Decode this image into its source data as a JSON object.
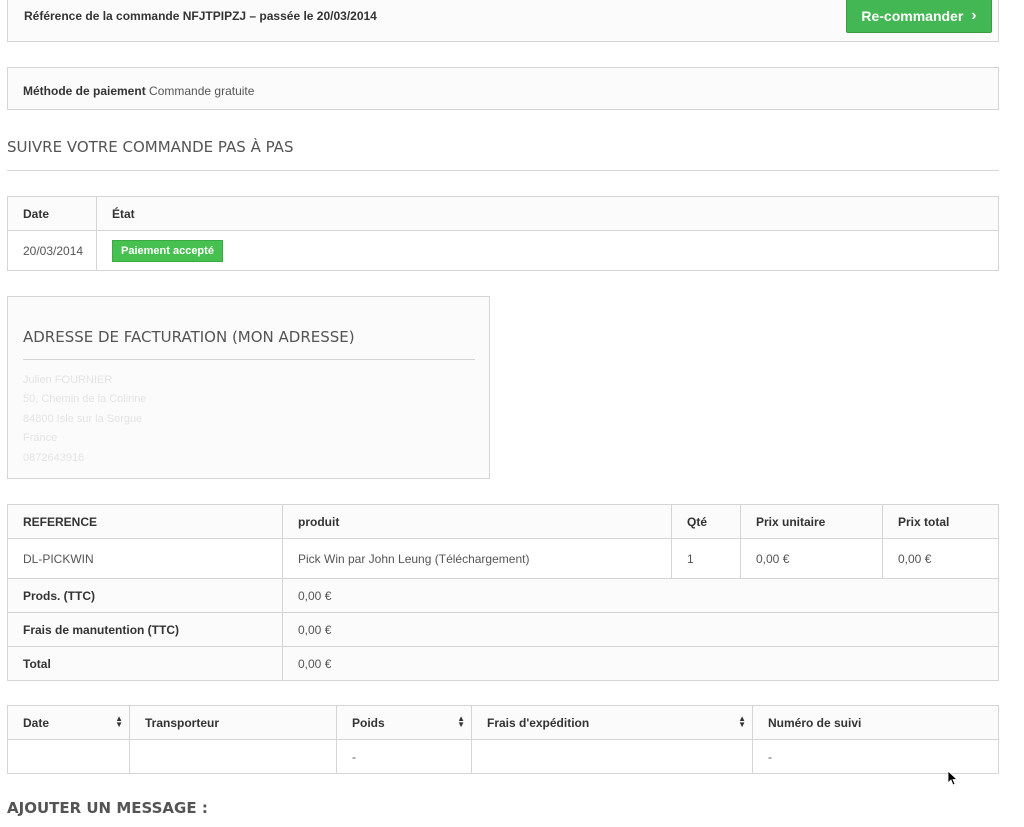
{
  "order": {
    "reference_label": "Référence de la commande NFJTPIPZJ – passée le 20/03/2014",
    "reorder_label": "Re-commander",
    "payment_label": "Méthode de paiement",
    "payment_value": "Commande gratuite"
  },
  "tracking": {
    "title": "SUIVRE VOTRE COMMANDE PAS À PAS",
    "headers": [
      "Date",
      "État"
    ],
    "rows": [
      {
        "date": "20/03/2014",
        "status": "Paiement accepté"
      }
    ],
    "status_color": "#46c04f"
  },
  "billing": {
    "title": "ADRESSE DE FACTURATION (MON ADRESSE)",
    "lines": [
      "Julien FOURNIER",
      "50, Chemin de la Colinne",
      "84800 Isle sur la Sorgue",
      "France",
      "0872643916"
    ]
  },
  "products": {
    "headers": [
      "REFERENCE",
      "produit",
      "Qté",
      "Prix unitaire",
      "Prix total"
    ],
    "rows": [
      {
        "ref": "DL-PICKWIN",
        "name": "Pick Win par John Leung (Téléchargement)",
        "qty": "1",
        "unit": "0,00 €",
        "total": "0,00 €"
      }
    ],
    "summary": [
      {
        "label": "Prods. (TTC)",
        "value": "0,00 €"
      },
      {
        "label": "Frais de manutention (TTC)",
        "value": "0,00 €"
      },
      {
        "label": "Total",
        "value": "0,00 €"
      }
    ]
  },
  "shipping": {
    "headers": [
      "Date",
      "Transporteur",
      "Poids",
      "Frais d'expédition",
      "Numéro de suivi"
    ],
    "row": [
      "",
      "",
      "-",
      "",
      "-"
    ]
  },
  "message": {
    "title": "AJOUTER UN MESSAGE :"
  },
  "colors": {
    "accent": "#43b754",
    "border": "#d6d4d4"
  }
}
